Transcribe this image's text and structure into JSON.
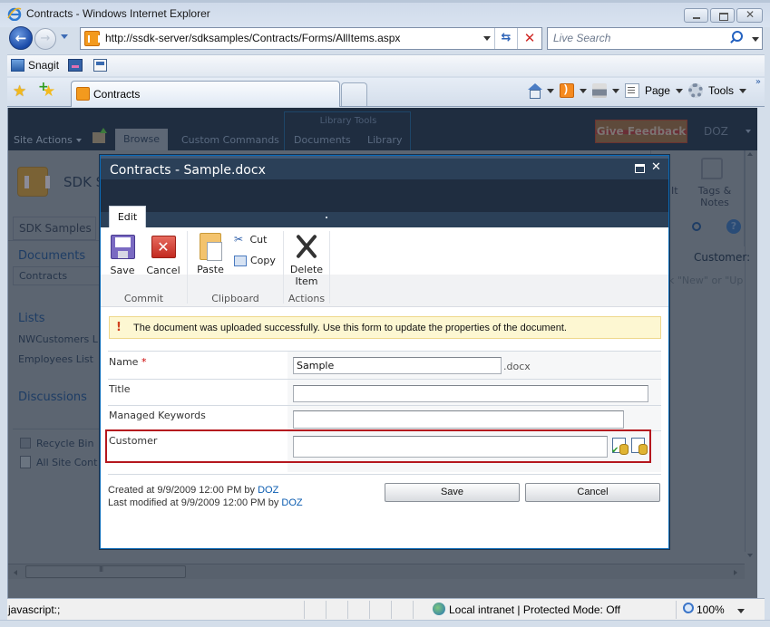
{
  "browser": {
    "window_title": "Contracts - Windows Internet Explorer",
    "address_url": "http://ssdk-server/sdksamples/Contracts/Forms/AllItems.aspx",
    "search_placeholder": "Live Search",
    "links": [
      {
        "label": "Snagit",
        "icon": "snagit-icon"
      },
      {
        "label": "",
        "icon": "toolbar-icon"
      },
      {
        "label": "",
        "icon": "edit-toolbar-icon"
      }
    ],
    "tab_label": "Contracts",
    "command_bar": {
      "page_label": "Page",
      "tools_label": "Tools",
      "more_label": "»"
    },
    "status": {
      "text": "javascript:;",
      "zone": "Local intranet | Protected Mode: Off",
      "zoom": "100%"
    }
  },
  "sharepoint": {
    "site_actions": "Site Actions",
    "ribbon_tabs": [
      "Browse",
      "Custom Commands",
      "Documents",
      "Library"
    ],
    "library_tools_label": "Library Tools",
    "give_feedback": "Give Feedback",
    "user": "DOZ",
    "site_title": "SDK S",
    "breadcrumb_tab": "SDK Samples",
    "ribbon_right": {
      "it_label": "It",
      "tags_label": "Tags & Notes"
    },
    "quick_launch": {
      "documents_heading": "Documents",
      "documents_items": [
        "Contracts"
      ],
      "lists_heading": "Lists",
      "lists_items": [
        "NWCustomers L",
        "Employees List"
      ],
      "discussions_heading": "Discussions",
      "footer_items": [
        "Recycle Bin",
        "All Site Cont"
      ]
    },
    "right_panel": {
      "customer_label": "Customer:",
      "hint": "k \"New\" or \"Up"
    }
  },
  "dialog": {
    "title": "Contracts - Sample.docx",
    "ribbon_tab": "Edit",
    "ribbon": {
      "commit": {
        "label": "Commit",
        "save": "Save",
        "cancel": "Cancel"
      },
      "clipboard": {
        "label": "Clipboard",
        "paste": "Paste",
        "cut": "Cut",
        "copy": "Copy"
      },
      "actions": {
        "label": "Actions",
        "delete_line1": "Delete",
        "delete_line2": "Item"
      }
    },
    "message": "The document was uploaded successfully. Use this form to update the properties of the document.",
    "fields": {
      "name": {
        "label": "Name",
        "required_marker": "*",
        "value": "Sample",
        "extension": ".docx"
      },
      "title": {
        "label": "Title",
        "value": ""
      },
      "managed_keywords": {
        "label": "Managed Keywords",
        "value": ""
      },
      "customer": {
        "label": "Customer",
        "value": ""
      }
    },
    "meta": {
      "created_prefix": "Created at 9/9/2009 12:00 PM by ",
      "created_by": "DOZ",
      "modified_prefix": "Last modified at 9/9/2009 12:00 PM by ",
      "modified_by": "DOZ"
    },
    "buttons": {
      "save": "Save",
      "cancel": "Cancel"
    }
  }
}
